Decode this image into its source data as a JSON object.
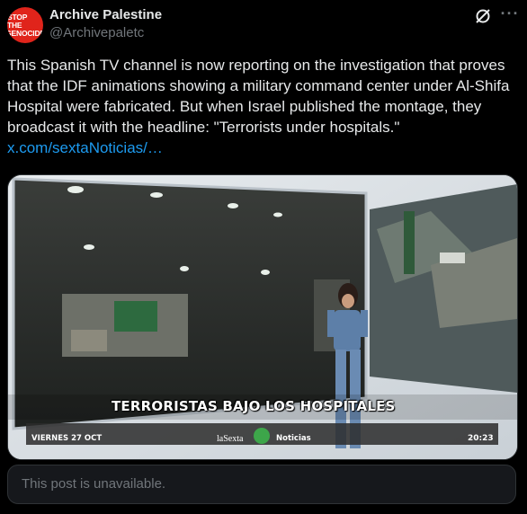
{
  "author": {
    "avatar_text_line1": "STOP THE",
    "avatar_text_line2": "GENOCIDE",
    "name": "Archive Palestine",
    "handle": "@Archivepaletc"
  },
  "post": {
    "text": "This Spanish TV channel is now reporting on the investigation that proves that the IDF animations showing a military command center under Al-Shifa Hospital were fabricated. But when Israel published the montage, they broadcast it with the headline: \"Terrorists under hospitals.\"",
    "link": "x.com/sextaNoticias/…"
  },
  "media": {
    "headline": "TERRORISTAS BAJO LOS HOSPITALES",
    "ticker_date": "VIERNES 27 OCT",
    "ticker_brand": "laSexta",
    "ticker_show": "Noticias",
    "ticker_time": "20:23"
  },
  "quoted": {
    "text": "This post is unavailable."
  },
  "icons": [
    "grok-icon",
    "more-icon"
  ],
  "colors": {
    "link": "#1d9bf0",
    "background": "#000000",
    "avatar": "#e0241b",
    "muted": "#71767b"
  }
}
